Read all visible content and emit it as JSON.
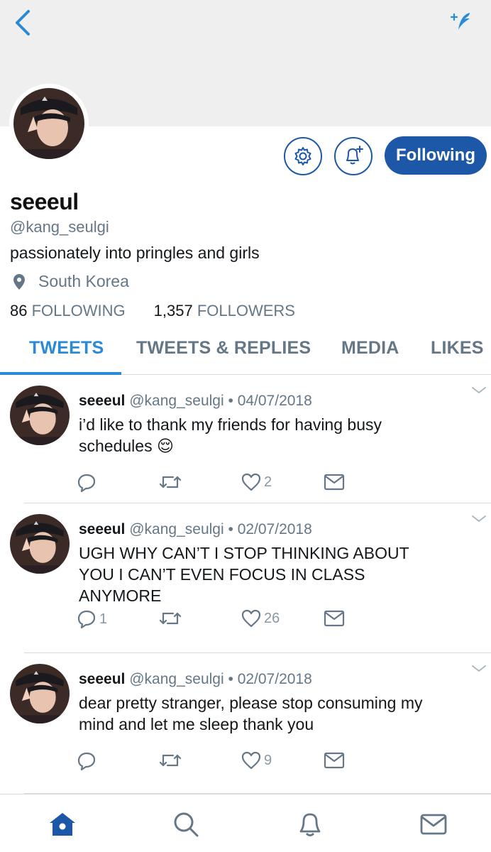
{
  "profile": {
    "display_name": "seeeul",
    "handle": "@kang_seulgi",
    "bio": "passionately into pringles and girls",
    "location": "South Korea",
    "following_count": "86",
    "following_label": "FOLLOWING",
    "followers_count": "1,357",
    "followers_label": "FOLLOWERS",
    "follow_button_label": "Following"
  },
  "tabs": [
    {
      "label": "TWEETS",
      "active": true
    },
    {
      "label": "TWEETS & REPLIES",
      "active": false
    },
    {
      "label": "MEDIA",
      "active": false
    },
    {
      "label": "LIKES",
      "active": false
    }
  ],
  "tweets": [
    {
      "name": "seeeul",
      "handle": "@kang_seulgi",
      "date": "04/07/2018",
      "text_line1": "i’d like to thank my friends for having busy",
      "text_line2": "schedules 😌",
      "text_line3": "",
      "replies": "",
      "retweets": "",
      "likes": "2"
    },
    {
      "name": "seeeul",
      "handle": "@kang_seulgi",
      "date": "02/07/2018",
      "text_line1": "UGH WHY CAN’T I STOP THINKING ABOUT",
      "text_line2": "YOU I CAN’T EVEN FOCUS IN CLASS",
      "text_line3": "ANYMORE",
      "replies": "1",
      "retweets": "",
      "likes": "26"
    },
    {
      "name": "seeeul",
      "handle": "@kang_seulgi",
      "date": "02/07/2018",
      "text_line1": "dear pretty stranger, please stop consuming my",
      "text_line2": "mind and let me sleep thank you",
      "text_line3": "",
      "replies": "",
      "retweets": "",
      "likes": "9"
    }
  ],
  "nav": {
    "icons": [
      "home-icon",
      "search-icon",
      "bell-icon",
      "mail-icon"
    ]
  },
  "colors": {
    "accent": "#1d57a8",
    "tab_active": "#2a8ad8",
    "muted": "#657786",
    "action_gray": "#8899a6"
  }
}
